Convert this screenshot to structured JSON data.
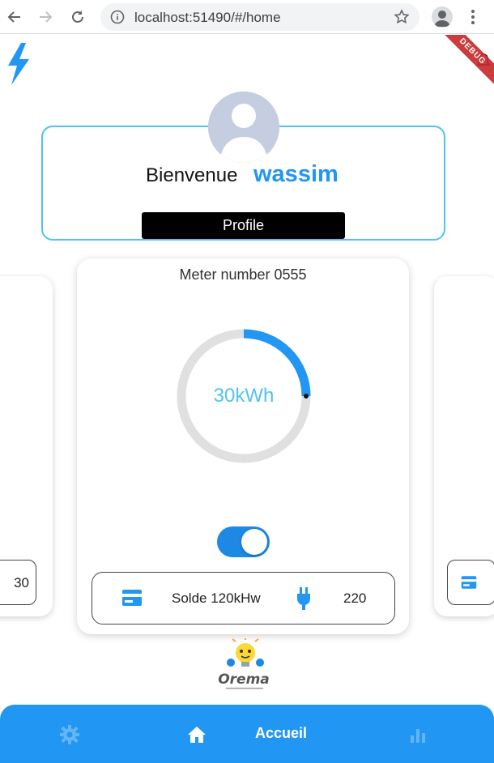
{
  "browser": {
    "url": "localhost:51490/#/home",
    "back_icon": "arrow-left-icon",
    "forward_icon": "arrow-right-icon",
    "reload_icon": "reload-icon"
  },
  "app": {
    "debug_banner": "DEBUG",
    "welcome": {
      "greeting": "Bienvenue",
      "username": "wassim",
      "profile_button": "Profile"
    },
    "side_left_value": "30",
    "meter": {
      "title": "Meter number 0555",
      "gauge_label": "30kWh",
      "gauge_fraction": 0.25,
      "toggle_on": true,
      "solde": "Solde 120kHw",
      "voltage": "220"
    },
    "bottom_nav": {
      "active_label": "Accueil",
      "items": [
        "settings-icon",
        "home-icon",
        "bar-chart-icon"
      ]
    },
    "logo_text": "Orema",
    "colors": {
      "primary": "#2196f3",
      "accent": "#4fc3f7",
      "gauge_track": "#e0e0e0"
    }
  }
}
